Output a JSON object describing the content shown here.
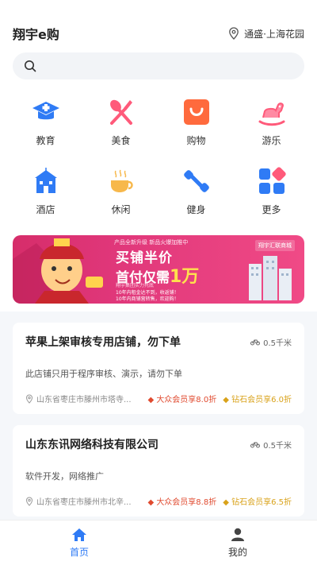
{
  "header": {
    "title": "翔宇e购",
    "location": "通盛·上海花园"
  },
  "categories": [
    {
      "label": "教育",
      "icon": "graduation-cap-icon"
    },
    {
      "label": "美食",
      "icon": "fork-knife-icon"
    },
    {
      "label": "购物",
      "icon": "shopping-bag-icon"
    },
    {
      "label": "游乐",
      "icon": "rocking-horse-icon"
    },
    {
      "label": "酒店",
      "icon": "hotel-icon"
    },
    {
      "label": "休闲",
      "icon": "coffee-cup-icon"
    },
    {
      "label": "健身",
      "icon": "dumbbell-icon"
    },
    {
      "label": "更多",
      "icon": "more-grid-icon"
    }
  ],
  "banner": {
    "top": "产品全新升级 新品火爆加推中",
    "line1": "买铺半价",
    "line2_prefix": "首付仅需",
    "line2_amount": "1万",
    "sub": "翔宇集团实力托底",
    "note1": "10年内租金达不到，收返铺！",
    "note2": "10年内商铺营转售，欢迎购！",
    "mall": "翔宇汇联商城"
  },
  "stores": [
    {
      "name": "苹果上架审核专用店铺，勿下单",
      "distance": "0.5千米",
      "desc": "此店铺只用于程序审核、演示，请勿下单",
      "address": "山东省枣庄市滕州市塔寺...",
      "tag1": "大众会员享8.0折",
      "tag2": "钻石会员享6.0折"
    },
    {
      "name": "山东东讯网络科技有限公司",
      "distance": "0.5千米",
      "desc": "软件开发，网络推广",
      "address": "山东省枣庄市滕州市北辛...",
      "tag1": "大众会员享8.8折",
      "tag2": "钻石会员享6.5折"
    }
  ],
  "tabs": [
    {
      "label": "首页",
      "icon": "home-icon",
      "active": true
    },
    {
      "label": "我的",
      "icon": "user-icon",
      "active": false
    }
  ],
  "colors": {
    "accent": "#2f7bf5",
    "tag_red": "#e04a2f",
    "tag_gold": "#d9a21a"
  }
}
